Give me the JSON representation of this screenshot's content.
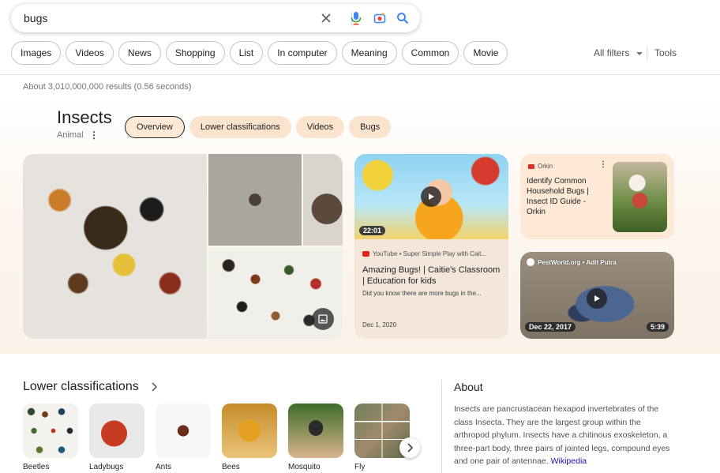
{
  "search": {
    "query": "bugs",
    "icons": [
      "close-icon",
      "mic-icon",
      "camera-icon",
      "search-icon"
    ]
  },
  "filters": {
    "chips": [
      "Images",
      "Videos",
      "News",
      "Shopping",
      "List",
      "In computer",
      "Meaning",
      "Common",
      "Movie"
    ],
    "all_filters": "All filters",
    "tools": "Tools"
  },
  "result_stats": "About 3,010,000,000 results (0.56 seconds)",
  "knowledge_panel": {
    "title": "Insects",
    "subtitle": "Animal",
    "tabs": [
      "Overview",
      "Lower classifications",
      "Videos",
      "Bugs"
    ]
  },
  "video_card": {
    "duration": "22:01",
    "source": "YouTube • Super Simple Play with Cait...",
    "title": "Amazing Bugs! | Caitie's Classroom | Education for kids",
    "description": "Did you know there are more bugs in the...",
    "date": "Dec 1, 2020"
  },
  "orkin_card": {
    "source": "Orkin",
    "title": "Identify Common Household Bugs | Insect ID Guide - Orkin"
  },
  "pest_card": {
    "source": "PestWorld.org • Adit Putra",
    "date": "Dec 22, 2017",
    "duration": "5:39"
  },
  "lower_classifications": {
    "title": "Lower classifications",
    "items": [
      "Beetles",
      "Ladybugs",
      "Ants",
      "Bees",
      "Mosquito",
      "Fly"
    ]
  },
  "about": {
    "title": "About",
    "text": "Insects are pancrustacean hexapod invertebrates of the class Insecta. They are the largest group within the arthropod phylum. Insects have a chitinous exoskeleton, a three-part body, three pairs of jointed legs, compound eyes and one pair of antennae.",
    "link": "Wikipedia"
  },
  "colors": {
    "accent_blue": "#1a73e8",
    "tab_bg": "#fbe4cd",
    "link": "#1a0dab"
  }
}
